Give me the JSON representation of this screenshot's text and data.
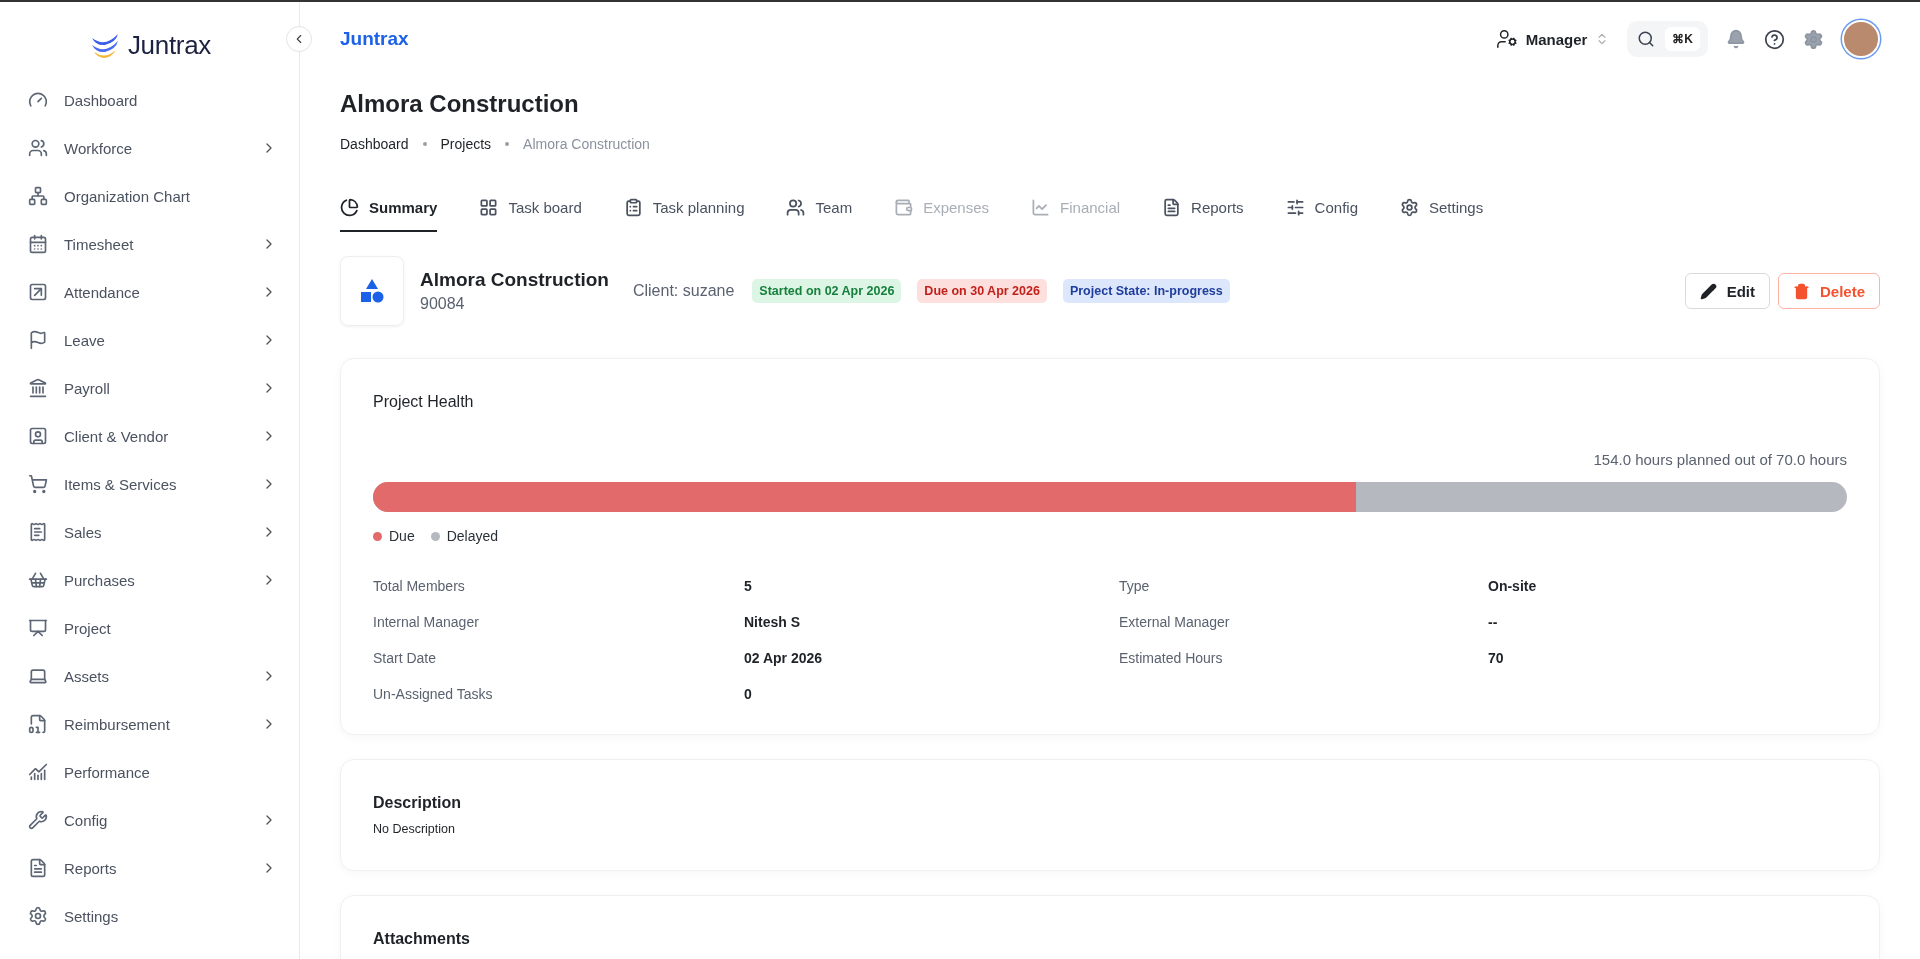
{
  "sidebar": {
    "logo": "Juntrax",
    "items": [
      {
        "label": "Dashboard",
        "has_submenu": false
      },
      {
        "label": "Workforce",
        "has_submenu": true
      },
      {
        "label": "Organization Chart",
        "has_submenu": false
      },
      {
        "label": "Timesheet",
        "has_submenu": true
      },
      {
        "label": "Attendance",
        "has_submenu": true
      },
      {
        "label": "Leave",
        "has_submenu": true
      },
      {
        "label": "Payroll",
        "has_submenu": true
      },
      {
        "label": "Client & Vendor",
        "has_submenu": true
      },
      {
        "label": "Items & Services",
        "has_submenu": true
      },
      {
        "label": "Sales",
        "has_submenu": true
      },
      {
        "label": "Purchases",
        "has_submenu": true
      },
      {
        "label": "Project",
        "has_submenu": false
      },
      {
        "label": "Assets",
        "has_submenu": true
      },
      {
        "label": "Reimbursement",
        "has_submenu": true
      },
      {
        "label": "Performance",
        "has_submenu": false
      },
      {
        "label": "Config",
        "has_submenu": true
      },
      {
        "label": "Reports",
        "has_submenu": true
      },
      {
        "label": "Settings",
        "has_submenu": false
      }
    ]
  },
  "topbar": {
    "brand": "Juntrax",
    "role": "Manager",
    "shortcut": "⌘K"
  },
  "page": {
    "title": "Almora Construction",
    "breadcrumb": [
      {
        "label": "Dashboard",
        "current": false
      },
      {
        "label": "Projects",
        "current": false
      },
      {
        "label": "Almora Construction",
        "current": true
      }
    ]
  },
  "tabs": [
    {
      "label": "Summary",
      "selected": true,
      "disabled": false
    },
    {
      "label": "Task board",
      "selected": false,
      "disabled": false
    },
    {
      "label": "Task planning",
      "selected": false,
      "disabled": false
    },
    {
      "label": "Team",
      "selected": false,
      "disabled": false
    },
    {
      "label": "Expenses",
      "selected": false,
      "disabled": true
    },
    {
      "label": "Financial",
      "selected": false,
      "disabled": true
    },
    {
      "label": "Reports",
      "selected": false,
      "disabled": false
    },
    {
      "label": "Config",
      "selected": false,
      "disabled": false
    },
    {
      "label": "Settings",
      "selected": false,
      "disabled": false
    }
  ],
  "project": {
    "name": "Almora Construction",
    "code": "90084",
    "client": "Client: suzane",
    "badges": [
      {
        "label": "Started on 02 Apr 2026",
        "kind": "success"
      },
      {
        "label": "Due on 30 Apr 2026",
        "kind": "danger"
      },
      {
        "label": "Project State: In-progress",
        "kind": "info"
      }
    ],
    "actions": [
      {
        "label": "Edit",
        "kind": "edit"
      },
      {
        "label": "Delete",
        "kind": "delete"
      }
    ]
  },
  "health": {
    "title": "Project Health",
    "summary": "154.0 hours planned out of 70.0 hours",
    "level": 0.667,
    "legend": [
      {
        "label": "Due",
        "color": "#e26a6a"
      },
      {
        "label": "Delayed",
        "color": "#b5b9bf"
      }
    ],
    "details": [
      {
        "label": "Total Members",
        "value": "5"
      },
      {
        "label": "Type",
        "value": "On-site"
      },
      {
        "label": "Internal Manager",
        "value": "Nitesh S"
      },
      {
        "label": "External Manager",
        "value": "--"
      },
      {
        "label": "Start Date",
        "value": "02 Apr 2026"
      },
      {
        "label": "Estimated Hours",
        "value": "70"
      },
      {
        "label": "Un-Assigned Tasks",
        "value": "0"
      }
    ]
  },
  "description": {
    "title": "Description",
    "text": "No Description"
  },
  "attachments": {
    "title": "Attachments"
  }
}
